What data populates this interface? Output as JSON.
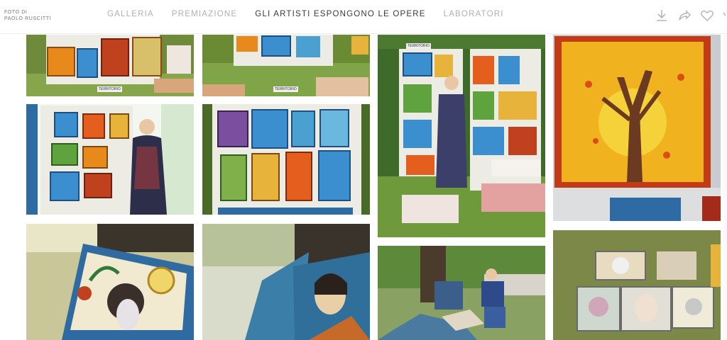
{
  "brand": {
    "line1": "Foto di",
    "line2": "Paolo Ruscitti"
  },
  "nav": [
    {
      "label": "GALLERIA",
      "active": false
    },
    {
      "label": "PREMIAZIONE",
      "active": false
    },
    {
      "label": "GLI ARTISTI ESPONGONO LE OPERE",
      "active": true
    },
    {
      "label": "LABORATORI",
      "active": false
    }
  ],
  "actions": {
    "download": "download-icon",
    "share": "share-icon",
    "favorite": "heart-icon",
    "extra": "more-icon"
  },
  "gallery": {
    "photos": [
      {
        "id": "p1",
        "sign": "TERRITORIO"
      },
      {
        "id": "p2",
        "sign": "TERRITORIO"
      },
      {
        "id": "p3",
        "sign": "TERRITORIO"
      },
      {
        "id": "p4",
        "sign": ""
      },
      {
        "id": "p5",
        "sign": ""
      },
      {
        "id": "p6",
        "sign": ""
      },
      {
        "id": "p7",
        "sign": ""
      },
      {
        "id": "p8",
        "sign": ""
      },
      {
        "id": "p9",
        "sign": ""
      },
      {
        "id": "p10",
        "sign": ""
      }
    ]
  },
  "colors": {
    "accent": "#3a3a3a",
    "muted": "#b0b0b0",
    "grass": "#5d7a2e",
    "pegboard": "#eceae2"
  }
}
